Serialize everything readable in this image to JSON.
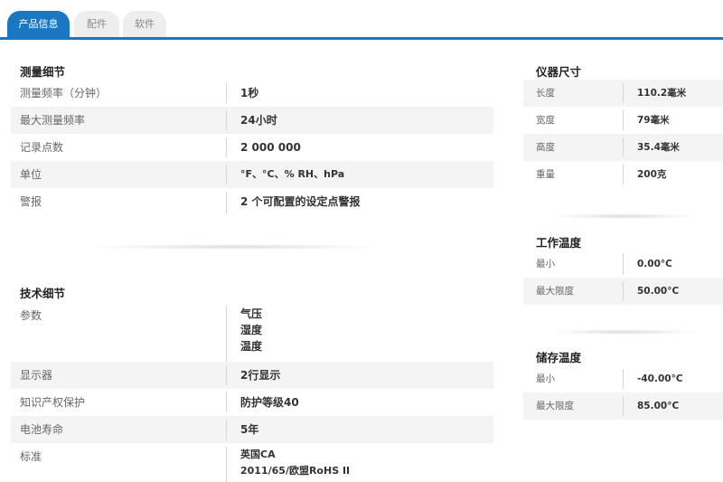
{
  "tabs": [
    {
      "label": "产品信息",
      "active": true
    },
    {
      "label": "配件",
      "active": false
    },
    {
      "label": "软件",
      "active": false
    }
  ],
  "measurement": {
    "title": "测量细节",
    "rows": [
      {
        "label": "测量频率（分钟）",
        "value": "1秒"
      },
      {
        "label": "最大测量频率",
        "value": "24小时"
      },
      {
        "label": "记录点数",
        "value": "2 000 000"
      },
      {
        "label": "单位",
        "value": "°F、°C、% RH、hPa"
      },
      {
        "label": "警报",
        "value": "2 个可配置的设定点警报"
      }
    ]
  },
  "technical": {
    "title": "技术细节",
    "params": {
      "label": "参数",
      "values": [
        "气压",
        "湿度",
        "温度"
      ]
    },
    "rows": [
      {
        "label": "显示器",
        "value": "2行显示"
      },
      {
        "label": "知识产权保护",
        "value": "防护等级40"
      },
      {
        "label": "电池寿命",
        "value": "5年"
      }
    ],
    "standard": {
      "label": "标准",
      "values": [
        "英国CA",
        "2011/65/欧盟RoHS II"
      ]
    }
  },
  "dimensions": {
    "title": "仪器尺寸",
    "rows": [
      {
        "label": "长度",
        "value": "110.2毫米"
      },
      {
        "label": "宽度",
        "value": "79毫米"
      },
      {
        "label": "高度",
        "value": "35.4毫米"
      },
      {
        "label": "重量",
        "value": "200克"
      }
    ]
  },
  "working_temp": {
    "title": "工作温度",
    "rows": [
      {
        "label": "最小",
        "value": "0.00°C"
      },
      {
        "label": "最大限度",
        "value": "50.00°C"
      }
    ]
  },
  "storage_temp": {
    "title": "储存温度",
    "rows": [
      {
        "label": "最小",
        "value": "-40.00°C"
      },
      {
        "label": "最大限度",
        "value": "85.00°C"
      }
    ]
  },
  "colors": {
    "accent": "#1a78c2",
    "row_shade": "#f4f4f4"
  }
}
